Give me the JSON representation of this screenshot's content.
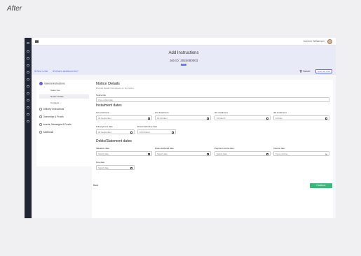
{
  "page_label": "After",
  "topbar": {
    "user_name": "Carmen Williamson"
  },
  "header": {
    "title": "Add Instructions",
    "job_id": "Job ID: 2024080003",
    "badge": "Draft",
    "link1": "⊞ New Letter",
    "link2": "⊞ What's additional info?",
    "cancel": "🗑 Cancel",
    "save_draft": "Save as draft"
  },
  "steps": {
    "general": "General Instructions",
    "sub_items": [
      "Sales Fee",
      "Notice details",
      "Contacts"
    ],
    "delivery": "Delivery Instructions",
    "ownership": "Ownership & Proofs",
    "inserts": "Inserts, Messages & Proofs",
    "additional": "Additional"
  },
  "form": {
    "notice_title": "Notice Details",
    "notice_desc": "Provide details that appear on the notice.",
    "notice_title_label": "Notice title",
    "notice_title_placeholder": "Type notice title",
    "installment_heading": "Instalment dates",
    "inst1_label": "1st instalment",
    "inst1_value": "30 September",
    "inst2_label": "2nd instalment",
    "inst2_value": "01 October",
    "inst3_label": "3rd instalment",
    "inst3_value": "31 March",
    "inst4_label": "4th instalment",
    "inst4_value": "31 May",
    "full_label": "Full payment date",
    "full_value": "30 September",
    "direct_label": "Direct Debit due date",
    "direct_value": "01 October",
    "debts_heading": "Debts/Statement dates",
    "valuation_label": "Valuation date",
    "valuation_placeholder": "Select date",
    "rates_label": "Rates declared date",
    "rates_placeholder": "Select date",
    "payment_label": "Payment arrival date",
    "payment_placeholder": "Select date",
    "interest_label": "Interest rate",
    "interest_placeholder": "Type number",
    "due_label": "Due date",
    "due_placeholder": "Select date"
  },
  "footer": {
    "back": "Back",
    "continue": "Continue"
  }
}
